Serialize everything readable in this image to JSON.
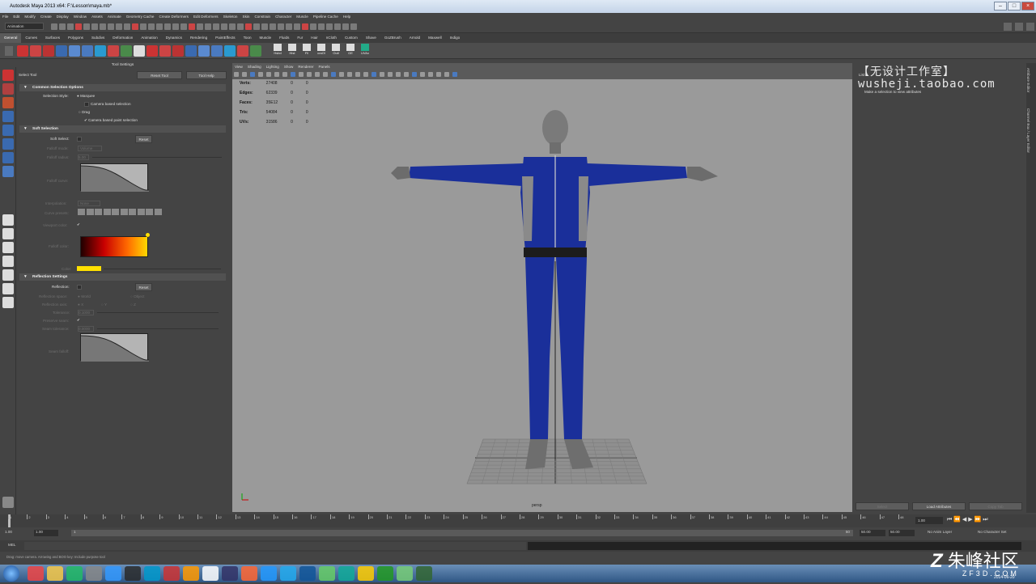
{
  "window": {
    "title": "Autodesk Maya 2013 x64: F:\\Lesson\\maya.mb*"
  },
  "menu": [
    "File",
    "Edit",
    "Modify",
    "Create",
    "Display",
    "Window",
    "Assets",
    "Animate",
    "Geometry Cache",
    "Create Deformers",
    "Edit Deformers",
    "Skeleton",
    "Skin",
    "Constrain",
    "Character",
    "Muscle",
    "Pipeline Cache",
    "Help"
  ],
  "menuset": "Animation",
  "shelf_tabs": [
    "General",
    "Curves",
    "Surfaces",
    "Polygons",
    "Subdivs",
    "Deformation",
    "Animation",
    "Dynamics",
    "Rendering",
    "PaintEffects",
    "Toon",
    "Muscle",
    "Fluids",
    "Fur",
    "Hair",
    "nCloth",
    "Custom",
    "Shave",
    "GoZBrush",
    "Arnold",
    "Maxwell",
    "Indigo"
  ],
  "shelf_labels": [
    "Hsbd",
    "Hist",
    "Fil",
    "craOl",
    "Outl",
    "GE",
    "UVAx"
  ],
  "tool_settings": {
    "title": "Tool Settings",
    "tool_name": "Select Tool",
    "reset_tool": "Reset Tool",
    "tool_help": "Tool Help",
    "common": {
      "header": "Common Selection Options",
      "selection_style": "Selection Style:",
      "marquee": "Marquee",
      "camera_based": "Camera based selection",
      "drag": "Drag",
      "camera_paint": "Camera based paint selection"
    },
    "soft": {
      "header": "Soft Selection",
      "soft_select": "Soft Select:",
      "reset": "Reset",
      "falloff_mode": "Falloff mode:",
      "falloff_mode_val": "Volume",
      "falloff_radius": "Falloff radius:",
      "falloff_radius_val": "5.00",
      "falloff_curve": "Falloff curve:",
      "interpolation": "Interpolation:",
      "interpolation_val": "None",
      "curve_presets": "Curve presets:",
      "viewport_color": "Viewport color:",
      "falloff_color": "Falloff color:",
      "color": "Color:"
    },
    "reflection": {
      "header": "Reflection Settings",
      "reflection": "Reflection:",
      "reset": "Reset",
      "space": "Reflection space:",
      "world": "World",
      "object": "Object",
      "axis": "Reflection axis:",
      "x": "X",
      "y": "Y",
      "z": "Z",
      "tolerance": "Tolerance:",
      "tolerance_val": "0.1000",
      "preserve_seam": "Preserve seam:",
      "seam_tolerance": "Seam tolerance:",
      "seam_tolerance_val": "0.0000",
      "seam_falloff": "Seam falloff:"
    }
  },
  "viewport": {
    "menu": [
      "View",
      "Shading",
      "Lighting",
      "Show",
      "Renderer",
      "Panels"
    ],
    "camera": "persp",
    "hud": [
      {
        "label": "Verts:",
        "a": "27408",
        "b": "0",
        "c": "0"
      },
      {
        "label": "Edges:",
        "a": "62339",
        "b": "0",
        "c": "0"
      },
      {
        "label": "Faces:",
        "a": "35E12",
        "b": "0",
        "c": "0"
      },
      {
        "label": "Tris:",
        "a": "54084",
        "b": "0",
        "c": "0"
      },
      {
        "label": "UVs:",
        "a": "31586",
        "b": "0",
        "c": "0"
      }
    ]
  },
  "attribute_editor": {
    "tab": "List",
    "hint": "Make a selection to view attributes",
    "select": "Select",
    "load_attributes": "Load Attributes",
    "copy_tab": "Copy Tab"
  },
  "watermark": "【无设计工作室】\nwusheji.taobao.com",
  "side_tabs": [
    "Attribute Editor",
    "Channel Box / Layer Editor"
  ],
  "timeline": {
    "ticks": [
      "1",
      "2",
      "3",
      "4",
      "5",
      "6",
      "7",
      "8",
      "9",
      "10",
      "11",
      "12",
      "13",
      "14",
      "15",
      "16",
      "17",
      "18",
      "19",
      "20",
      "21",
      "22",
      "23",
      "24",
      "25",
      "26",
      "27",
      "28",
      "29",
      "30",
      "31",
      "32",
      "33",
      "34",
      "35",
      "36",
      "37",
      "38",
      "39",
      "40",
      "41",
      "42",
      "43",
      "44",
      "45",
      "46",
      "47",
      "48"
    ],
    "current": "1.00"
  },
  "range": {
    "start": "1.00",
    "start2": "1.00",
    "cur": "1",
    "end": "50",
    "end2": "50.00",
    "end3": "50.00",
    "anim_layer": "No Anim Layer",
    "char_set": "No Character Set"
  },
  "cmd": {
    "label": "MEL"
  },
  "help": "Drag: move camera. Arrowing and BOO key: Include purpose tool",
  "taskbar": {
    "clock": "2014-06-20"
  },
  "logo": "朱峰社区",
  "logo_url": "ZF3D.COM",
  "colors": {
    "accent": "#ffe000",
    "suit": "#1a2f9a",
    "viewport_bg": "#9a9a9a"
  }
}
